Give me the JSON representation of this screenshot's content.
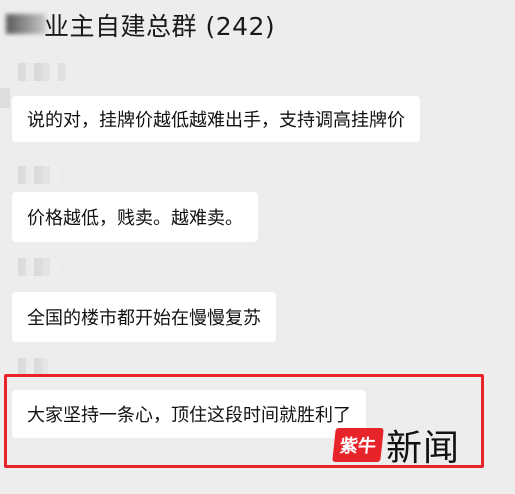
{
  "header": {
    "chat_title": "业主自建总群 (242)"
  },
  "messages": [
    {
      "text": "说的对，挂牌价越低越难出手，支持调高挂牌价"
    },
    {
      "text": "价格越低，贱卖。越难卖。"
    },
    {
      "text": "全国的楼市都开始在慢慢复苏"
    },
    {
      "text": "大家坚持一条心，顶住这段时间就胜利了"
    }
  ],
  "watermark": {
    "logo_mark": "紫牛",
    "logo_text": "新闻"
  },
  "colors": {
    "background": "#ededed",
    "bubble": "#ffffff",
    "highlight": "#e8242b"
  }
}
